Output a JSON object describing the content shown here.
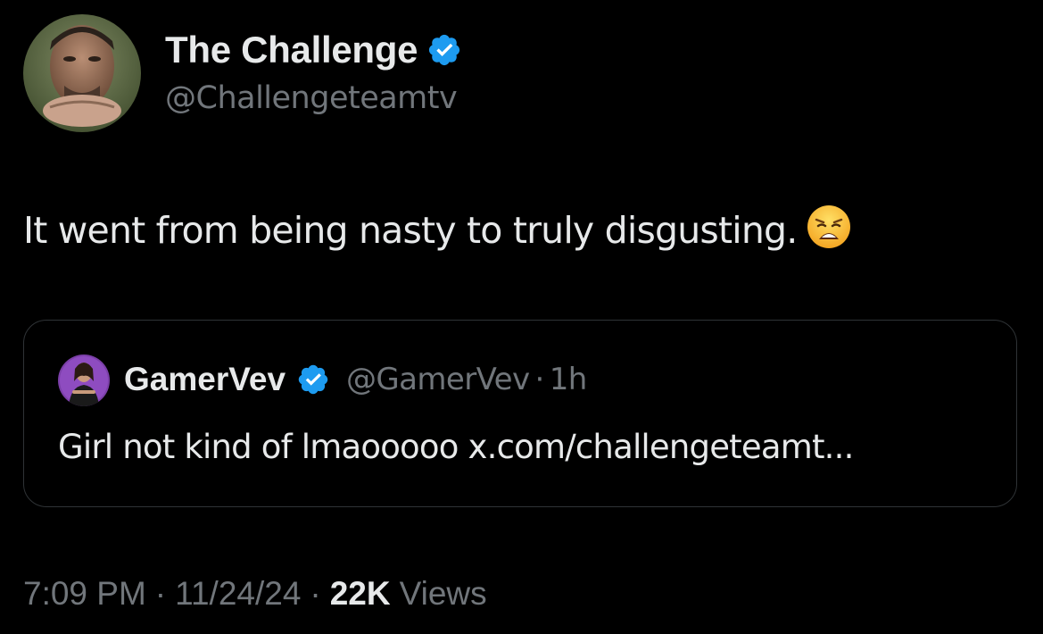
{
  "author": {
    "name": "The Challenge",
    "handle": "@Challengeteamtv",
    "verified": true,
    "verified_color": "#1d9bf0"
  },
  "tweet": {
    "text": "It went from being nasty to truly disgusting.",
    "emoji": "weary-face-emoji"
  },
  "quote": {
    "name": "GamerVev",
    "handle": "@GamerVev",
    "separator": "·",
    "time": "1h",
    "text": "Girl not kind of lmaooooo x.com/challengeteamt...",
    "verified": true
  },
  "meta": {
    "time": "7:09 PM",
    "date": "11/24/24",
    "separator": "·",
    "views_count": "22K",
    "views_label": "Views"
  },
  "colors": {
    "background": "#000000",
    "primary_text": "#e7e9ea",
    "secondary_text": "#71767b",
    "border": "#2f3336",
    "verified_blue": "#1d9bf0"
  }
}
